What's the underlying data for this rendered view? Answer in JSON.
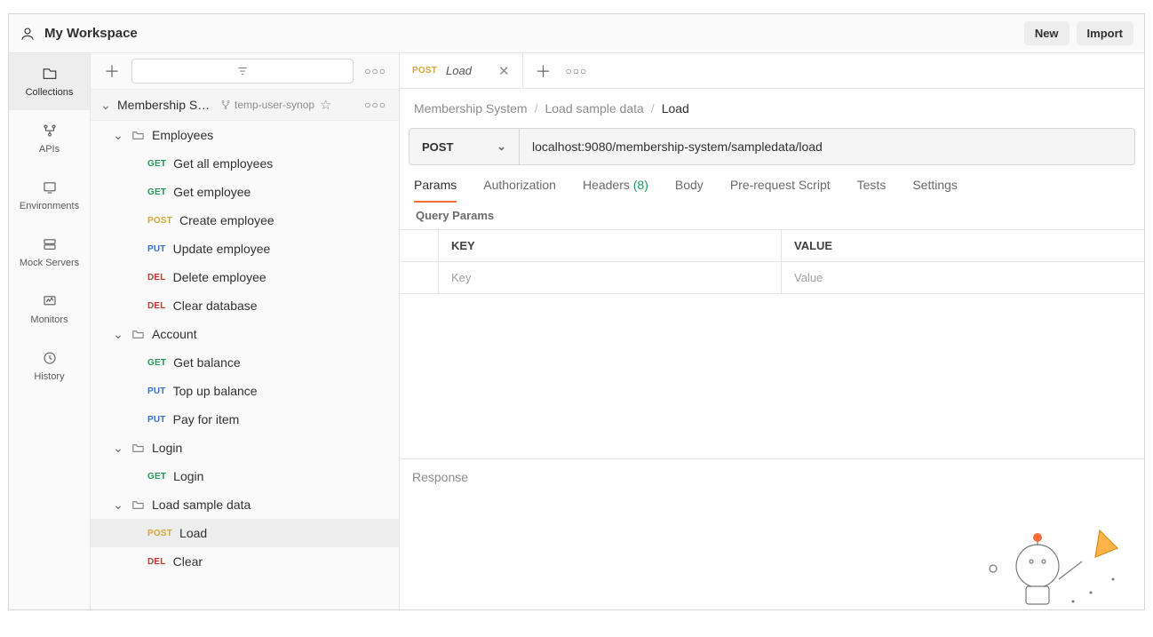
{
  "header": {
    "workspace": "My Workspace",
    "new_btn": "New",
    "import_btn": "Import"
  },
  "nav": {
    "items": [
      {
        "id": "collections",
        "label": "Collections"
      },
      {
        "id": "apis",
        "label": "APIs"
      },
      {
        "id": "environments",
        "label": "Environments"
      },
      {
        "id": "mock-servers",
        "label": "Mock Servers"
      },
      {
        "id": "monitors",
        "label": "Monitors"
      },
      {
        "id": "history",
        "label": "History"
      }
    ]
  },
  "collection": {
    "name": "Membership Sys...",
    "branch": "temp-user-synop"
  },
  "tree": [
    {
      "type": "folder",
      "name": "Employees",
      "children": [
        {
          "method": "GET",
          "name": "Get all employees"
        },
        {
          "method": "GET",
          "name": "Get employee"
        },
        {
          "method": "POST",
          "name": "Create employee"
        },
        {
          "method": "PUT",
          "name": "Update employee"
        },
        {
          "method": "DEL",
          "name": "Delete employee"
        },
        {
          "method": "DEL",
          "name": "Clear database"
        }
      ]
    },
    {
      "type": "folder",
      "name": "Account",
      "children": [
        {
          "method": "GET",
          "name": "Get balance"
        },
        {
          "method": "PUT",
          "name": "Top up balance"
        },
        {
          "method": "PUT",
          "name": "Pay for item"
        }
      ]
    },
    {
      "type": "folder",
      "name": "Login",
      "children": [
        {
          "method": "GET",
          "name": "Login"
        }
      ]
    },
    {
      "type": "folder",
      "name": "Load sample data",
      "children": [
        {
          "method": "POST",
          "name": "Load",
          "selected": true
        },
        {
          "method": "DEL",
          "name": "Clear"
        }
      ]
    }
  ],
  "tab": {
    "method": "POST",
    "title": "Load"
  },
  "breadcrumb": {
    "a": "Membership System",
    "b": "Load sample data",
    "c": "Load"
  },
  "request": {
    "method": "POST",
    "url": "localhost:9080/membership-system/sampledata/load"
  },
  "request_tabs": {
    "params": "Params",
    "authorization": "Authorization",
    "headers_label": "Headers",
    "headers_count": "(8)",
    "body": "Body",
    "prerequest": "Pre-request Script",
    "tests": "Tests",
    "settings": "Settings"
  },
  "query_params_label": "Query Params",
  "params_table": {
    "key_header": "KEY",
    "value_header": "VALUE",
    "key_placeholder": "Key",
    "value_placeholder": "Value"
  },
  "response_label": "Response"
}
